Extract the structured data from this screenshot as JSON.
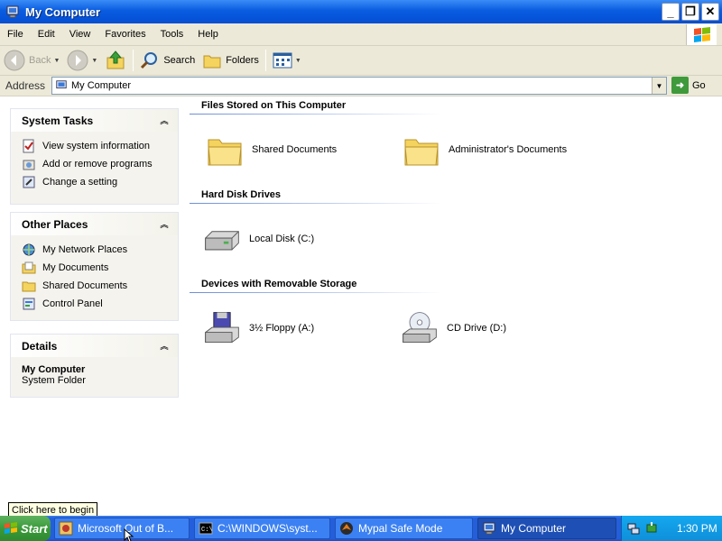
{
  "window": {
    "title": "My Computer"
  },
  "titlebar_buttons": {
    "minimize": "_",
    "maximize": "❐",
    "close": "✕"
  },
  "menu": [
    "File",
    "Edit",
    "View",
    "Favorites",
    "Tools",
    "Help"
  ],
  "toolbar": {
    "back": "Back",
    "search": "Search",
    "folders": "Folders"
  },
  "address": {
    "label": "Address",
    "value": "My Computer",
    "go": "Go"
  },
  "system_tasks": {
    "title": "System Tasks",
    "items": [
      "View system information",
      "Add or remove programs",
      "Change a setting"
    ]
  },
  "other_places": {
    "title": "Other Places",
    "items": [
      "My Network Places",
      "My Documents",
      "Shared Documents",
      "Control Panel"
    ]
  },
  "details": {
    "title": "Details",
    "name": "My Computer",
    "type": "System Folder"
  },
  "groups": {
    "files": {
      "title": "Files Stored on This Computer",
      "items": [
        "Shared Documents",
        "Administrator's Documents"
      ]
    },
    "disks": {
      "title": "Hard Disk Drives",
      "items": [
        "Local Disk (C:)"
      ]
    },
    "removable": {
      "title": "Devices with Removable Storage",
      "items": [
        "3½ Floppy (A:)",
        "CD Drive (D:)"
      ]
    }
  },
  "taskbar": {
    "start": "Start",
    "tooltip": "Click here to begin",
    "tasks": [
      "Microsoft Out of B...",
      "C:\\WINDOWS\\syst...",
      "Mypal Safe Mode",
      "My Computer"
    ],
    "clock": "1:30 PM"
  }
}
